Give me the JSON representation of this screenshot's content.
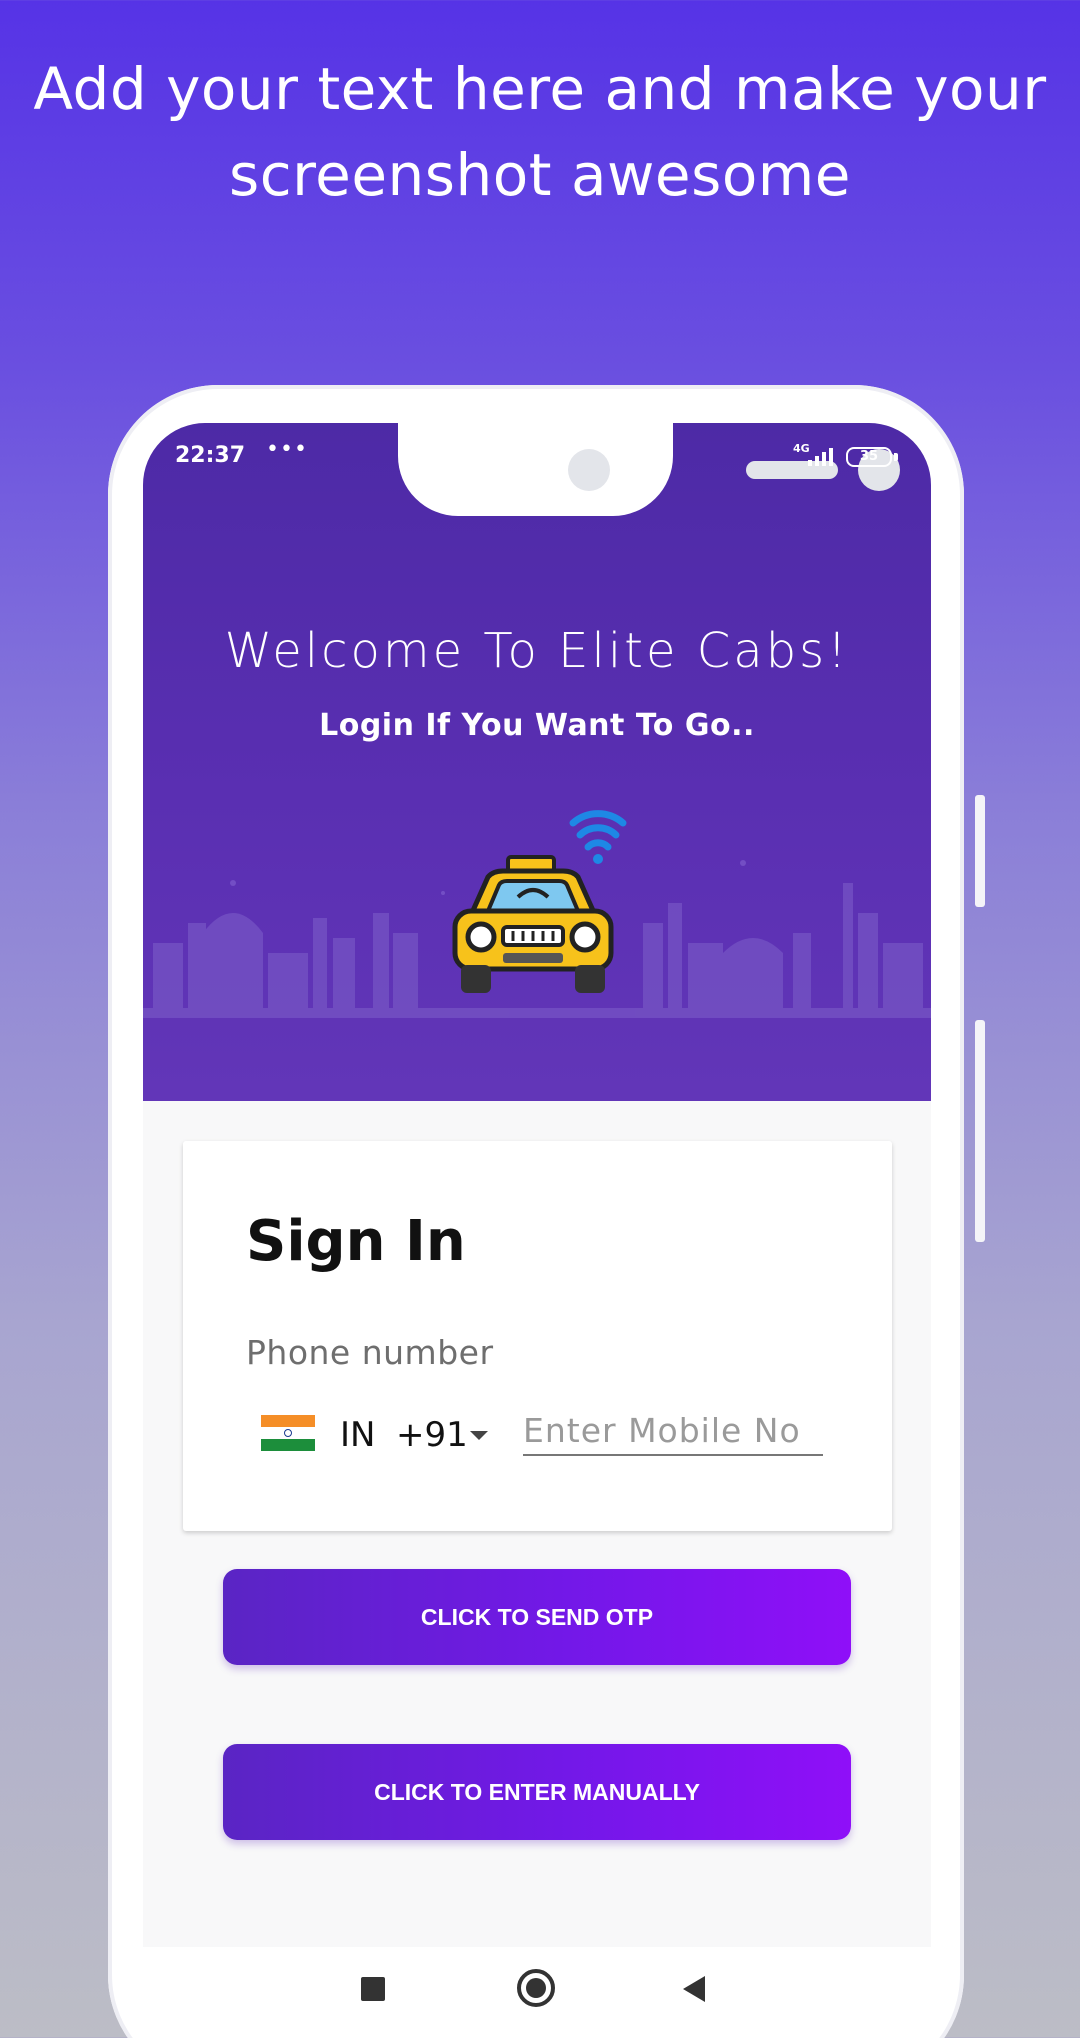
{
  "promo": {
    "line1": "Add your text here and make your",
    "line2": "screenshot awesome"
  },
  "status_bar": {
    "time": "22:37",
    "dots": "•••",
    "network": "4G",
    "battery": "35"
  },
  "header": {
    "welcome": "Welcome To Elite Cabs!",
    "subtitle": "Login If You Want To Go.."
  },
  "signin": {
    "title": "Sign In",
    "phone_label": "Phone number",
    "country": "IN",
    "dial_code": "+91",
    "mobile_placeholder": "Enter Mobile No",
    "mobile_value": ""
  },
  "buttons": {
    "send_otp": "CLICK TO SEND OTP",
    "enter_manually": "CLICK TO ENTER MANUALLY"
  },
  "icons": {
    "taxi": "taxi-wifi-icon",
    "flag": "india-flag-icon",
    "nav_recent": "square-icon",
    "nav_home": "circle-icon",
    "nav_back": "triangle-back-icon"
  },
  "colors": {
    "background_top": "#5633e6",
    "header": "#5a2fb2",
    "button_start": "#5a25c4",
    "button_end": "#8f0ff8"
  }
}
